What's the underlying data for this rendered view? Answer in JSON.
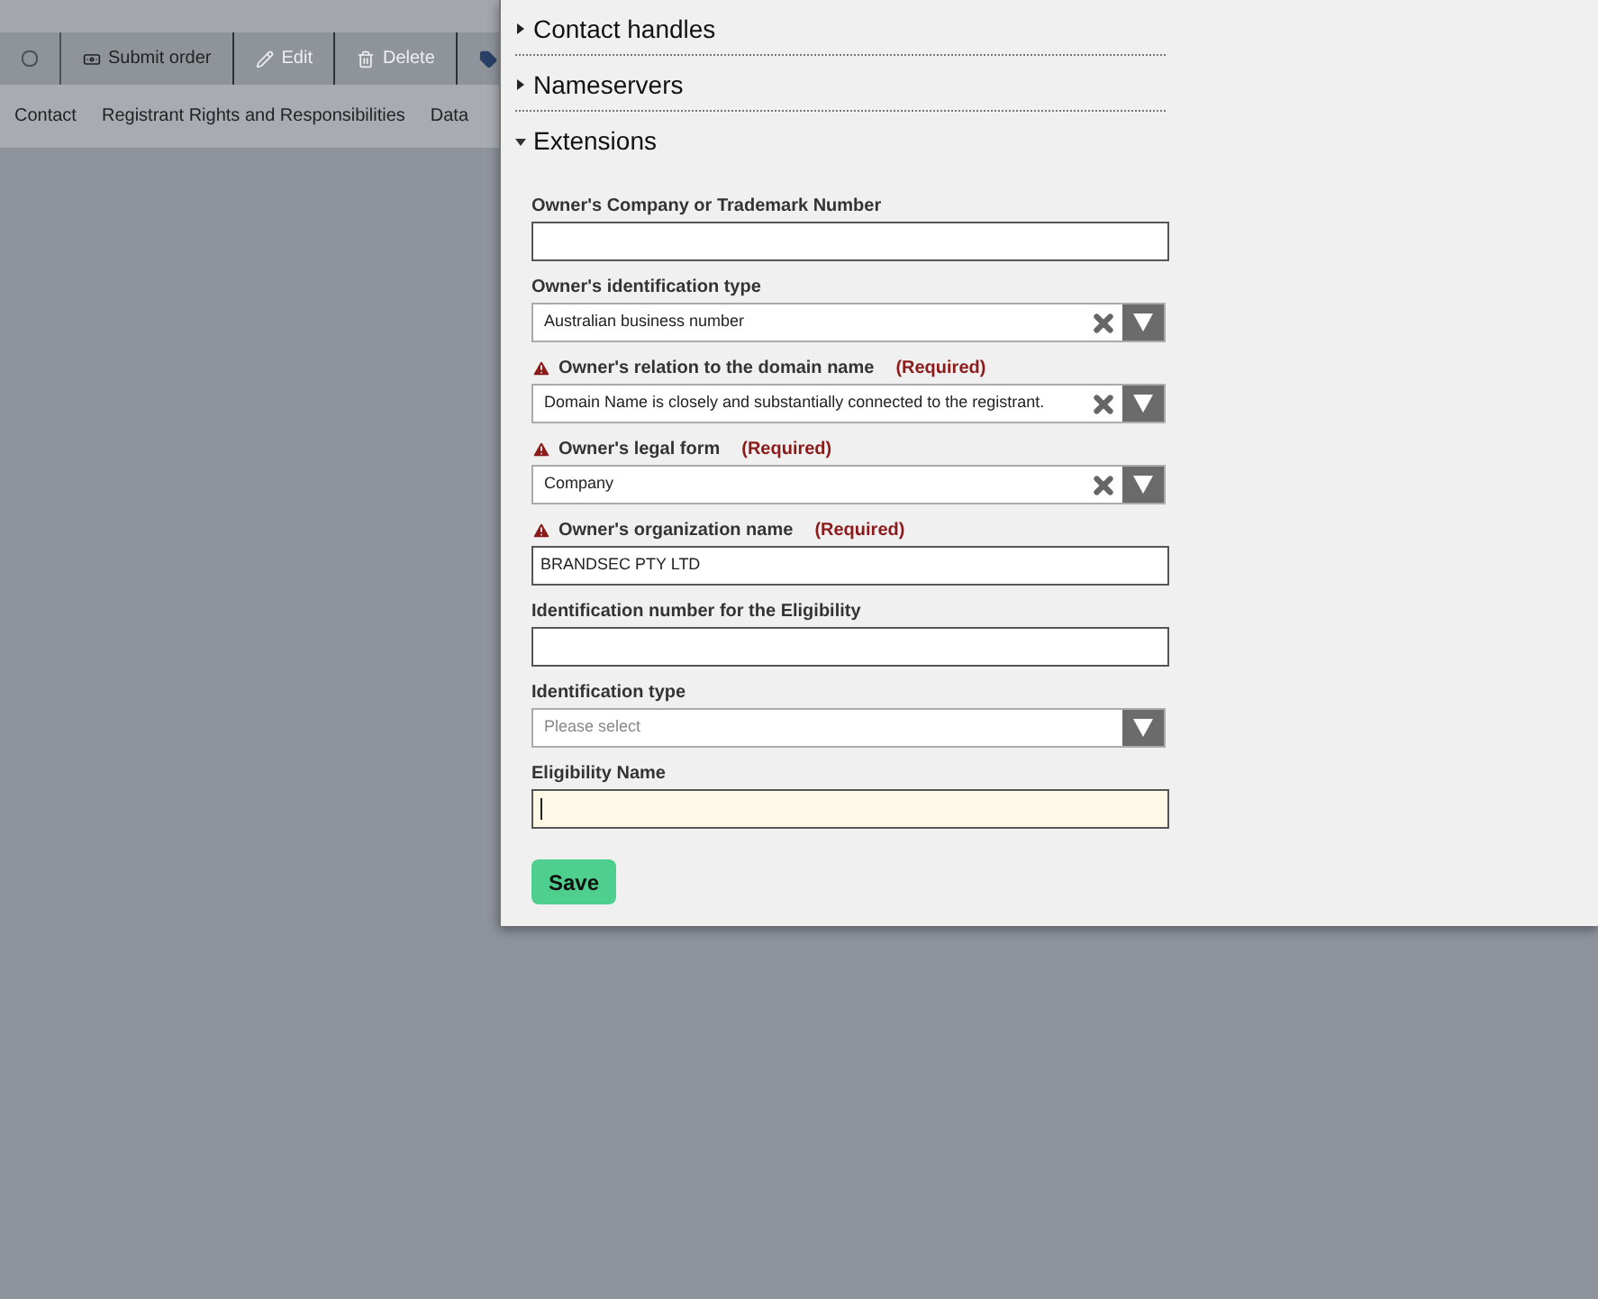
{
  "toolbar": [
    {
      "kind": "checkbox",
      "checked": false
    },
    {
      "kind": "submit",
      "label": "Submit order",
      "disabled": false
    },
    {
      "kind": "edit",
      "label": "Edit",
      "disabled": true
    },
    {
      "kind": "delete",
      "label": "Delete",
      "disabled": true
    },
    {
      "kind": "tag"
    }
  ],
  "tabs": [
    {
      "label": "Contact"
    },
    {
      "label": "Registrant Rights and Responsibilities"
    },
    {
      "label": "Data"
    }
  ],
  "panel": {
    "sections": [
      {
        "title": "Contact handles",
        "expanded": false
      },
      {
        "title": "Nameservers",
        "expanded": false
      },
      {
        "title": "Extensions",
        "expanded": true
      }
    ],
    "fields": [
      {
        "kind": "text",
        "label": "Owner's Company or Trademark Number",
        "required": false,
        "focused": false
      },
      {
        "kind": "select",
        "label": "Owner's identification type",
        "required": false,
        "value": "Australian business number"
      },
      {
        "kind": "select",
        "label": "Owner's relation to the domain name",
        "required": true,
        "required_text": "(Required)",
        "value": "Domain Name is closely and substantially connected to the registrant."
      },
      {
        "kind": "select",
        "label": "Owner's legal form",
        "required": true,
        "required_text": "(Required)",
        "value": "Company"
      },
      {
        "kind": "text",
        "label": "Owner's organization name",
        "required": true,
        "required_text": "(Required)",
        "value": "BRANDSEC PTY LTD",
        "focused": false
      },
      {
        "kind": "text",
        "label": "Identification number for the Eligibility",
        "required": false,
        "focused": false
      },
      {
        "kind": "select",
        "label": "Identification type",
        "required": false,
        "placeholder": "Please select"
      },
      {
        "kind": "text",
        "label": "Eligibility Name",
        "required": false,
        "focused": true
      }
    ],
    "save_button": "Save"
  }
}
